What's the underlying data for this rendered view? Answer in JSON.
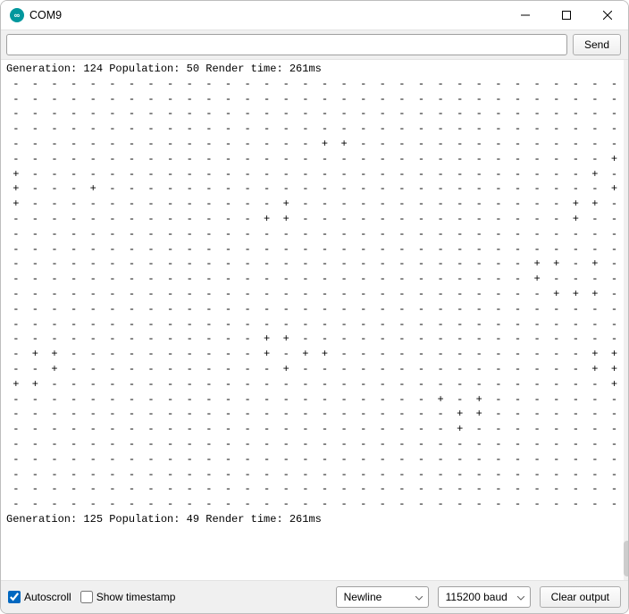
{
  "window": {
    "title": "COM9"
  },
  "input": {
    "value": "",
    "send_label": "Send"
  },
  "console": {
    "header": "Generation: 124 Population: 50 Render time: 261ms",
    "footer": "Generation: 125 Population: 49 Render time: 261ms",
    "rows": [
      " -  -  -  -  -  -  -  -  -  -  -  -  -  -  -  -  -  -  -  -  -  -  -  -  -  -  -  -  -  -  -  - ",
      " -  -  -  -  -  -  -  -  -  -  -  -  -  -  -  -  -  -  -  -  -  -  -  -  -  -  -  -  -  -  -  - ",
      " -  -  -  -  -  -  -  -  -  -  -  -  -  -  -  -  -  -  -  -  -  -  -  -  -  -  -  -  -  -  -  - ",
      " -  -  -  -  -  -  -  -  -  -  -  -  -  -  -  -  -  -  -  -  -  -  -  -  -  -  -  -  -  -  -  - ",
      " -  -  -  -  -  -  -  -  -  -  -  -  -  -  -  -  +  +  -  -  -  -  -  -  -  -  -  -  -  -  -  - ",
      " -  -  -  -  -  -  -  -  -  -  -  -  -  -  -  -  -  -  -  -  -  -  -  -  -  -  -  -  -  -  -  + ",
      " +  -  -  -  -  -  -  -  -  -  -  -  -  -  -  -  -  -  -  -  -  -  -  -  -  -  -  -  -  -  +  - ",
      " +  -  -  -  +  -  -  -  -  -  -  -  -  -  -  -  -  -  -  -  -  -  -  -  -  -  -  -  -  -  -  + ",
      " +  -  -  -  -  -  -  -  -  -  -  -  -  -  +  -  -  -  -  -  -  -  -  -  -  -  -  -  -  +  +  - ",
      " -  -  -  -  -  -  -  -  -  -  -  -  -  +  +  -  -  -  -  -  -  -  -  -  -  -  -  -  -  +  -  - ",
      " -  -  -  -  -  -  -  -  -  -  -  -  -  -  -  -  -  -  -  -  -  -  -  -  -  -  -  -  -  -  -  - ",
      " -  -  -  -  -  -  -  -  -  -  -  -  -  -  -  -  -  -  -  -  -  -  -  -  -  -  -  -  -  -  -  - ",
      " -  -  -  -  -  -  -  -  -  -  -  -  -  -  -  -  -  -  -  -  -  -  -  -  -  -  -  +  +  -  +  - ",
      " -  -  -  -  -  -  -  -  -  -  -  -  -  -  -  -  -  -  -  -  -  -  -  -  -  -  -  +  -  -  -  - ",
      " -  -  -  -  -  -  -  -  -  -  -  -  -  -  -  -  -  -  -  -  -  -  -  -  -  -  -  -  +  +  +  - ",
      " -  -  -  -  -  -  -  -  -  -  -  -  -  -  -  -  -  -  -  -  -  -  -  -  -  -  -  -  -  -  -  - ",
      " -  -  -  -  -  -  -  -  -  -  -  -  -  -  -  -  -  -  -  -  -  -  -  -  -  -  -  -  -  -  -  - ",
      " -  -  -  -  -  -  -  -  -  -  -  -  -  +  +  -  -  -  -  -  -  -  -  -  -  -  -  -  -  -  -  - ",
      " -  +  +  -  -  -  -  -  -  -  -  -  -  +  -  +  +  -  -  -  -  -  -  -  -  -  -  -  -  -  +  + ",
      " -  -  +  -  -  -  -  -  -  -  -  -  -  -  +  -  -  -  -  -  -  -  -  -  -  -  -  -  -  -  +  + ",
      " +  +  -  -  -  -  -  -  -  -  -  -  -  -  -  -  -  -  -  -  -  -  -  -  -  -  -  -  -  -  -  + ",
      " -  -  -  -  -  -  -  -  -  -  -  -  -  -  -  -  -  -  -  -  -  -  +  -  +  -  -  -  -  -  -  - ",
      " -  -  -  -  -  -  -  -  -  -  -  -  -  -  -  -  -  -  -  -  -  -  -  +  +  -  -  -  -  -  -  - ",
      " -  -  -  -  -  -  -  -  -  -  -  -  -  -  -  -  -  -  -  -  -  -  -  +  -  -  -  -  -  -  -  - ",
      " -  -  -  -  -  -  -  -  -  -  -  -  -  -  -  -  -  -  -  -  -  -  -  -  -  -  -  -  -  -  -  - ",
      " -  -  -  -  -  -  -  -  -  -  -  -  -  -  -  -  -  -  -  -  -  -  -  -  -  -  -  -  -  -  -  - ",
      " -  -  -  -  -  -  -  -  -  -  -  -  -  -  -  -  -  -  -  -  -  -  -  -  -  -  -  -  -  -  -  - ",
      " -  -  -  -  -  -  -  -  -  -  -  -  -  -  -  -  -  -  -  -  -  -  -  -  -  -  -  -  -  -  -  - ",
      " -  -  -  -  -  -  -  -  -  -  -  -  -  -  -  -  -  -  -  -  -  -  -  -  -  -  -  -  -  -  -  - "
    ]
  },
  "footer": {
    "autoscroll": {
      "label": "Autoscroll",
      "checked": true
    },
    "timestamp": {
      "label": "Show timestamp",
      "checked": false
    },
    "line_ending": {
      "selected": "Newline"
    },
    "baud": {
      "selected": "115200 baud"
    },
    "clear_label": "Clear output"
  }
}
